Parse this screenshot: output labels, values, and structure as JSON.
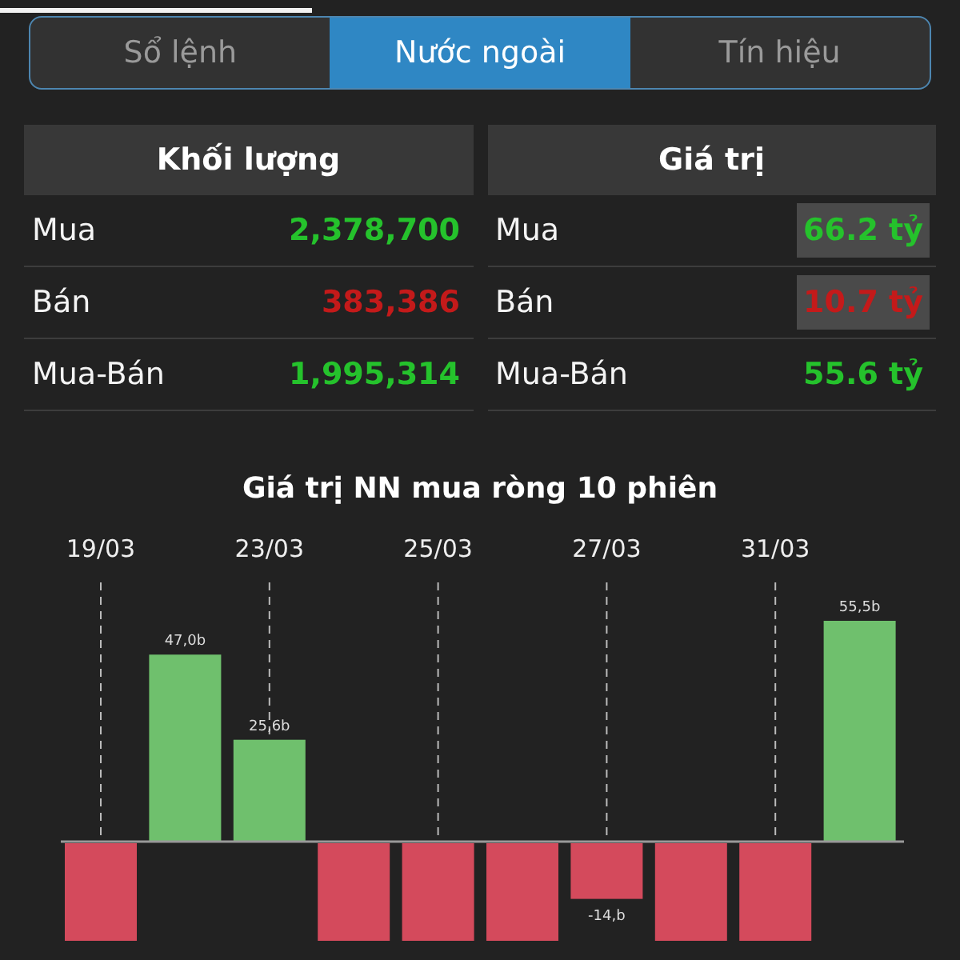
{
  "tabs": [
    {
      "label": "Sổ lệnh",
      "selected": false
    },
    {
      "label": "Nước ngoài",
      "selected": true
    },
    {
      "label": "Tín hiệu",
      "selected": false
    }
  ],
  "tables": [
    {
      "header": "Khối lượng",
      "rows": [
        {
          "label": "Mua",
          "value": "2,378,700",
          "color": "#25c22c",
          "highlighted": false
        },
        {
          "label": "Bán",
          "value": "383,386",
          "color": "#c41a1a",
          "highlighted": false
        },
        {
          "label": "Mua-Bán",
          "value": "1,995,314",
          "color": "#25c22c",
          "highlighted": false
        }
      ]
    },
    {
      "header": "Giá trị",
      "rows": [
        {
          "label": "Mua",
          "value": "66.2 tỷ",
          "color": "#25c22c",
          "highlighted": true
        },
        {
          "label": "Bán",
          "value": "10.7 tỷ",
          "color": "#c41a1a",
          "highlighted": true
        },
        {
          "label": "Mua-Bán",
          "value": "55.6 tỷ",
          "color": "#25c22c",
          "highlighted": false
        }
      ]
    }
  ],
  "chart": {
    "title": "Giá trị NN mua ròng 10 phiên",
    "date_labels": [
      "19/03",
      "23/03",
      "25/03",
      "27/03",
      "31/03"
    ],
    "bar_labels": [
      "47,0b",
      "25,6b",
      "-14,b",
      "55,5b"
    ]
  }
}
